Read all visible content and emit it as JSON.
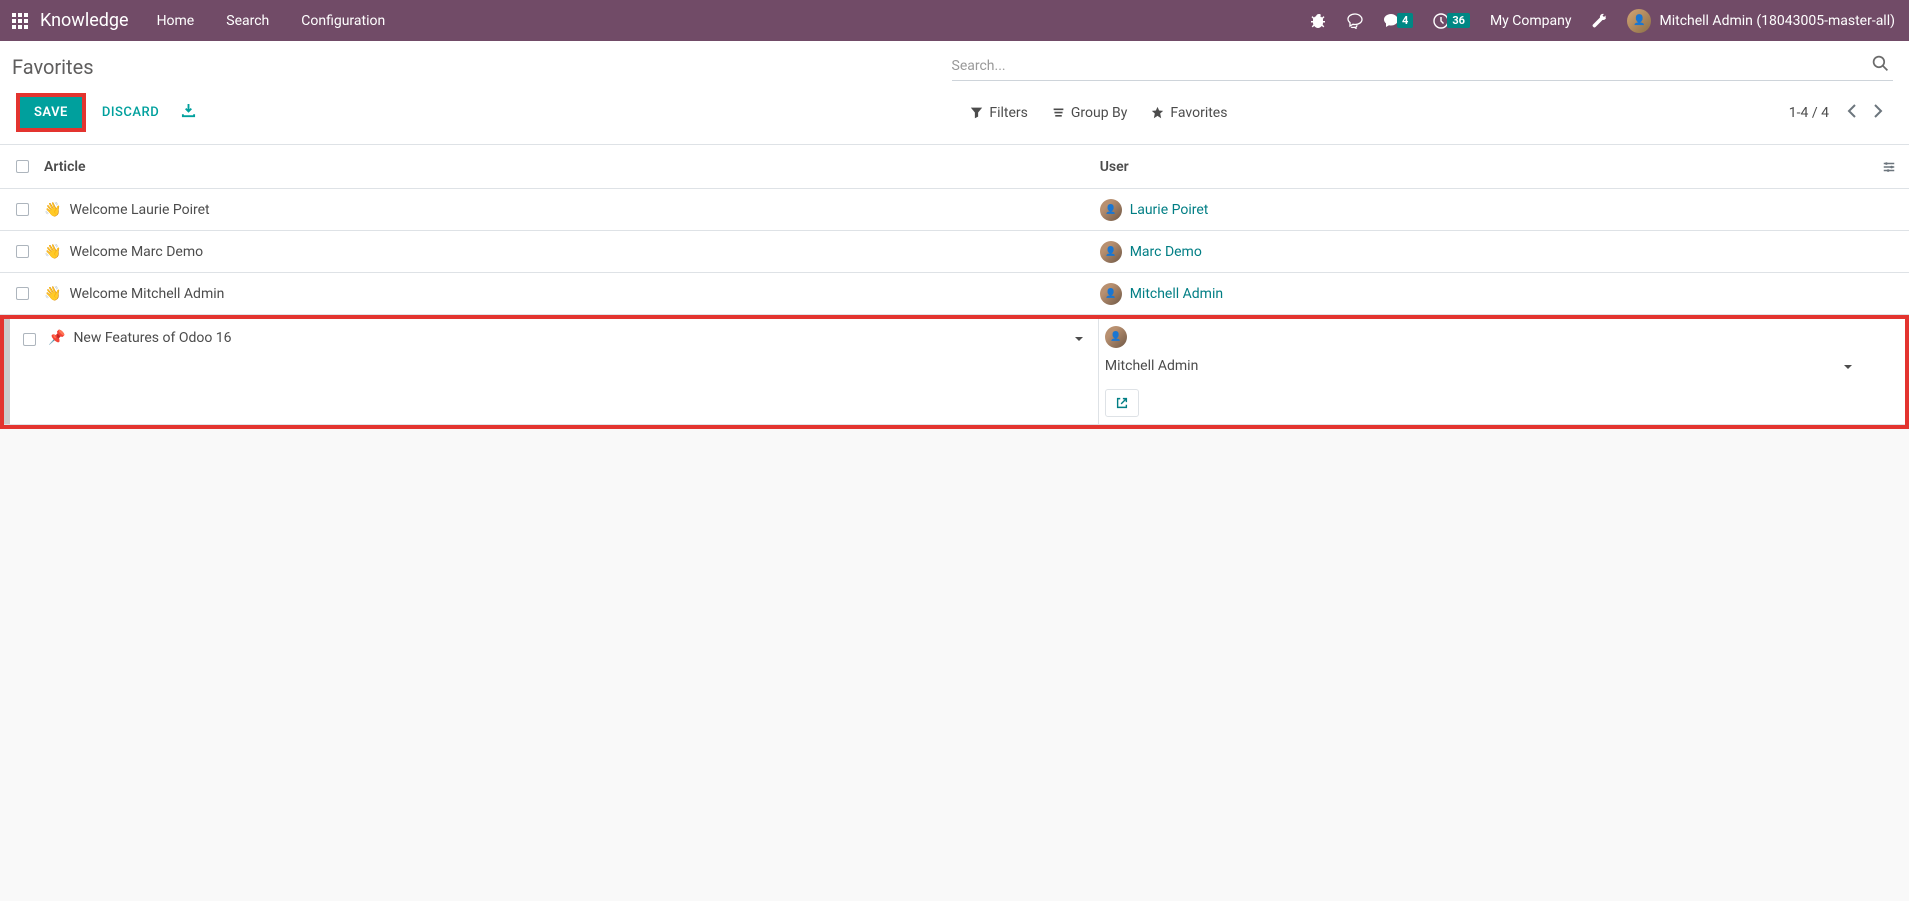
{
  "topnav": {
    "app_title": "Knowledge",
    "menu": [
      "Home",
      "Search",
      "Configuration"
    ],
    "chat_badge": "4",
    "activity_badge": "36",
    "company": "My Company",
    "user_name": "Mitchell Admin (18043005-master-all)"
  },
  "control_panel": {
    "breadcrumb": "Favorites",
    "search_placeholder": "Search...",
    "save_label": "SAVE",
    "discard_label": "DISCARD",
    "filters_label": "Filters",
    "groupby_label": "Group By",
    "favorites_label": "Favorites",
    "pager": "1-4 / 4"
  },
  "table": {
    "headers": {
      "article": "Article",
      "user": "User"
    },
    "rows": [
      {
        "emoji": "👋",
        "article": "Welcome Laurie Poiret",
        "user": "Laurie Poiret"
      },
      {
        "emoji": "👋",
        "article": "Welcome Marc Demo",
        "user": "Marc Demo"
      },
      {
        "emoji": "👋",
        "article": "Welcome Mitchell Admin",
        "user": "Mitchell Admin"
      }
    ],
    "edit_row": {
      "emoji": "📌",
      "article": "New Features of Odoo 16",
      "user": "Mitchell Admin"
    }
  }
}
